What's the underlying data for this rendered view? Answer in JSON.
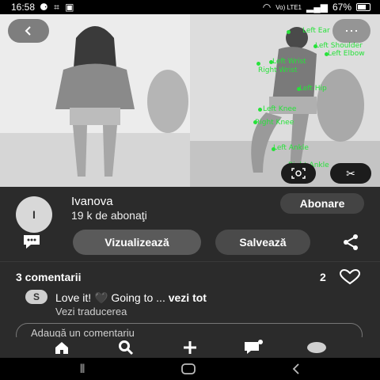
{
  "status_bar": {
    "time": "16:58",
    "network": "Vo) LTE1",
    "battery": "67%",
    "battery_level": 0.67
  },
  "media": {
    "pose_labels": [
      "Left Ear",
      "Left Shoulder",
      "Left Elbow",
      "Left Wrist",
      "Right Wrist",
      "Left Hip",
      "Left Knee",
      "Right Knee",
      "Left Ankle",
      "Right Ankle"
    ]
  },
  "pin": {
    "author_initial": "I",
    "author_name": "Ivanova",
    "followers": "19 k de abonaţi",
    "follow_label": "Abonare",
    "view_label": "Vizualizează",
    "save_label": "Salvează"
  },
  "comments": {
    "title": "3 comentarii",
    "likes": "2",
    "first": {
      "initial": "S",
      "text": "Love it! 🖤 Going to ... ",
      "see_all": "vezi tot",
      "translate": "Vezi traducerea"
    },
    "placeholder": "Adaugă un comentariu"
  },
  "colors": {
    "accent_pose": "#27e23a",
    "panel_bg": "#2b2b2b"
  },
  "icons": {
    "bottom_tabs": [
      "home-icon",
      "search-icon",
      "plus-icon",
      "chat-icon",
      "profile-icon"
    ],
    "system_nav": [
      "recent-apps-icon",
      "home-nav-icon",
      "back-nav-icon"
    ]
  }
}
